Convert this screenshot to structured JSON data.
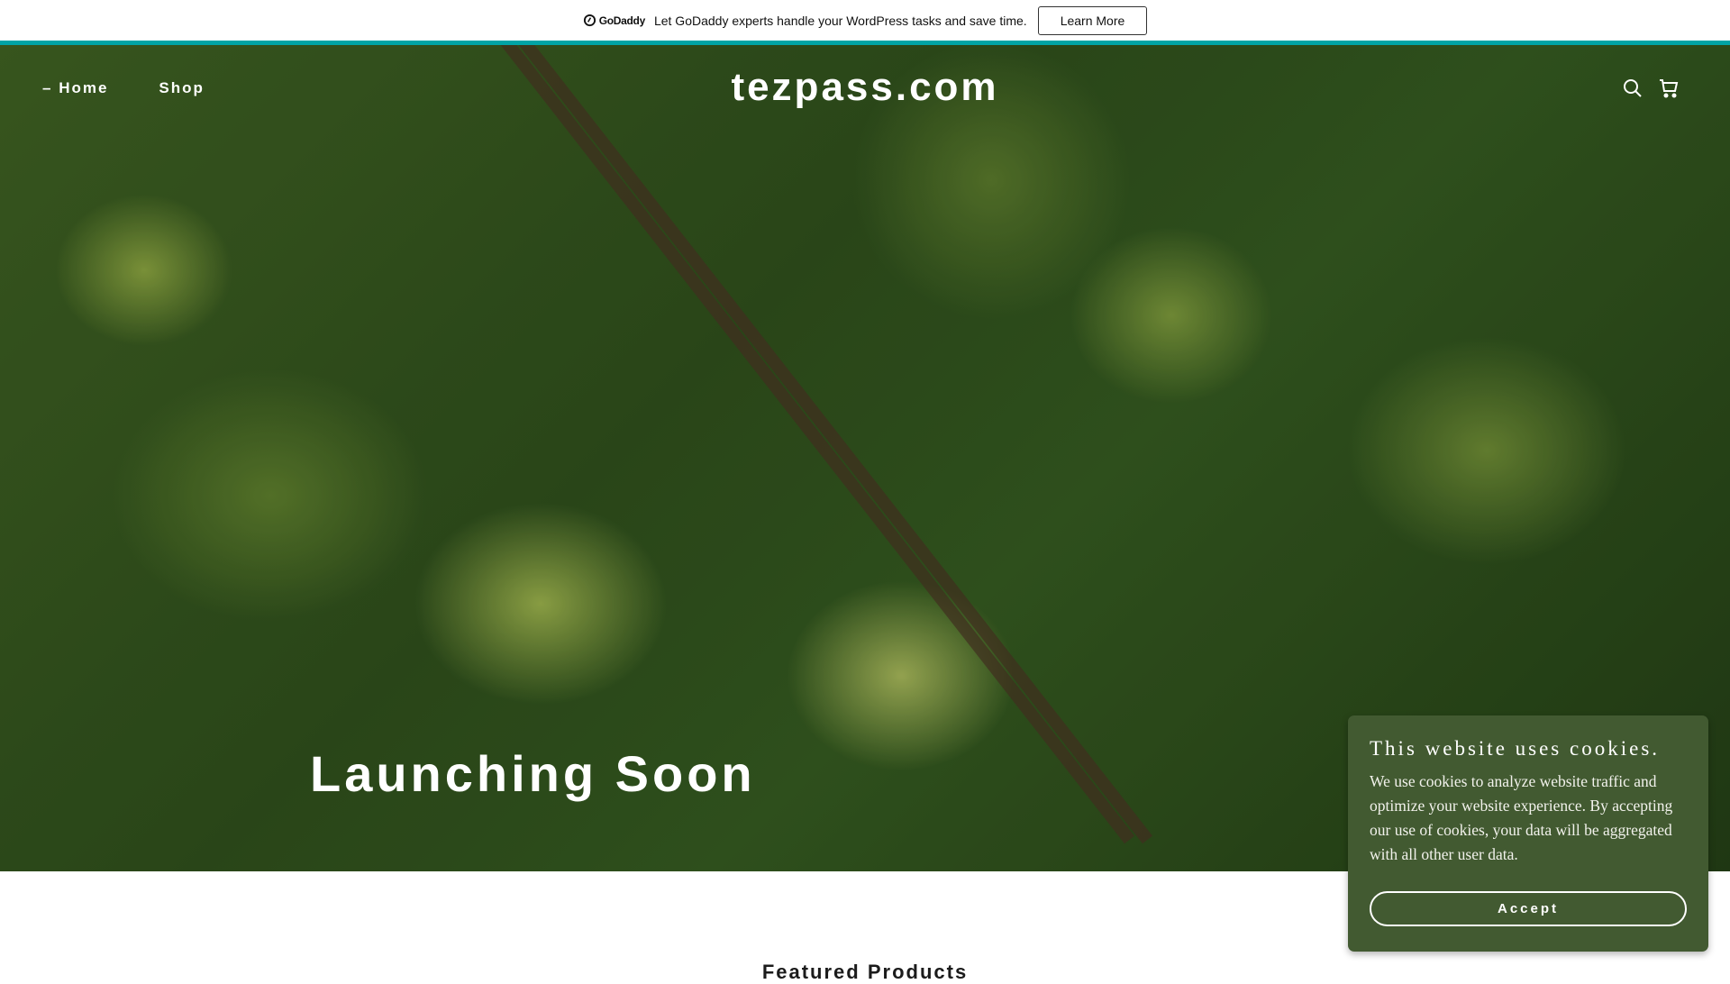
{
  "banner": {
    "logo": "GoDaddy",
    "message": "Let GoDaddy experts handle your WordPress tasks and save time.",
    "button": "Learn More"
  },
  "header": {
    "nav": [
      {
        "label": "Home",
        "active": true
      },
      {
        "label": "Shop"
      }
    ],
    "site_title": "tezpass.com",
    "icons": [
      "search-icon",
      "cart-icon"
    ]
  },
  "hero": {
    "heading": "Launching Soon"
  },
  "section": {
    "heading": "Featured Products"
  },
  "cookie": {
    "title": "This website uses cookies.",
    "body": "We use cookies to analyze website traffic and optimize your website experience. By accepting our use of cookies, your data will be aggregated with all other user data.",
    "button": "Accept",
    "bg": "#425a31"
  },
  "colors": {
    "accent": "#00a4a6"
  }
}
